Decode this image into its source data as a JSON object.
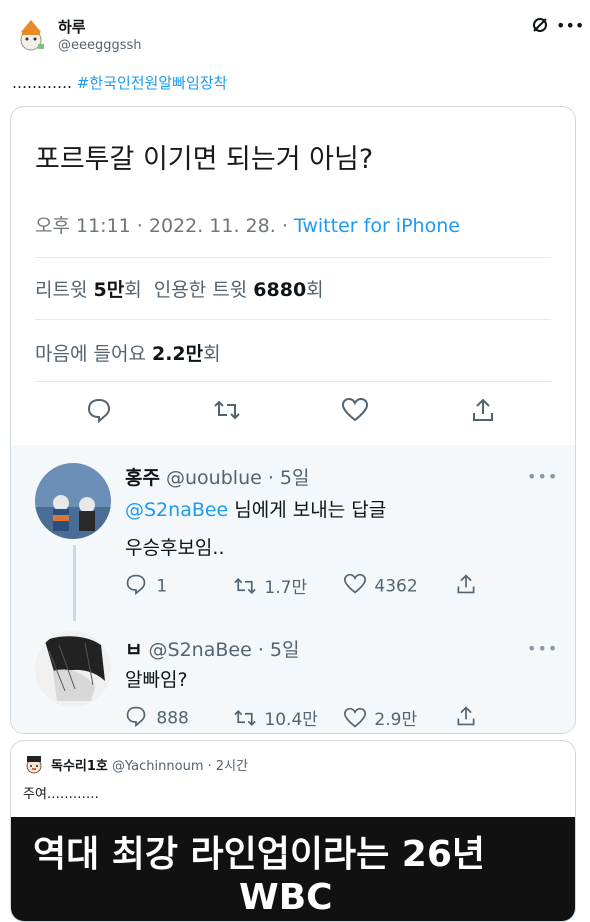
{
  "tweet": {
    "display_name": "하루",
    "handle": "@eeegggssh",
    "text_prefix": "………… ",
    "hashtag": "#한국인전원알빠임장착"
  },
  "screenshot": {
    "title": "포르투갈 이기면 되는거 아님?",
    "time": "오후 11:11 · 2022. 11. 28. ·",
    "source": "Twitter for iPhone",
    "retweet_label": "리트윗",
    "retweet_count": "5만",
    "retweet_unit": "회",
    "quote_label": "인용한 트윗",
    "quote_count": "6880",
    "quote_unit": "회",
    "like_label": "마음에 들어요",
    "like_count": "2.2만",
    "like_unit": "회",
    "replies": [
      {
        "name": "홍주",
        "handle": "@uoublue · 5일",
        "mention": "@S2naBee",
        "mention_suffix": " 님에게 보내는 답글",
        "text": "우승후보임..",
        "reply_count": "1",
        "retweet_count": "1.7만",
        "like_count": "4362"
      },
      {
        "name": "ㅂ",
        "handle": "@S2naBee · 5일",
        "text": "알빠임?",
        "reply_count": "888",
        "retweet_count": "10.4만",
        "like_count": "2.9만"
      }
    ]
  },
  "quote": {
    "name": "독수리1호",
    "handle": "@Yachinnoum · 2시간",
    "text": "주여…………",
    "banner_line1": "역대 최강 라인업이라는 26년",
    "banner_line2": "WBC"
  },
  "icons": {
    "more": "more-icon",
    "grok": "grok-icon",
    "reply": "reply-icon",
    "retweet": "retweet-icon",
    "like": "heart-icon",
    "share": "share-icon"
  }
}
